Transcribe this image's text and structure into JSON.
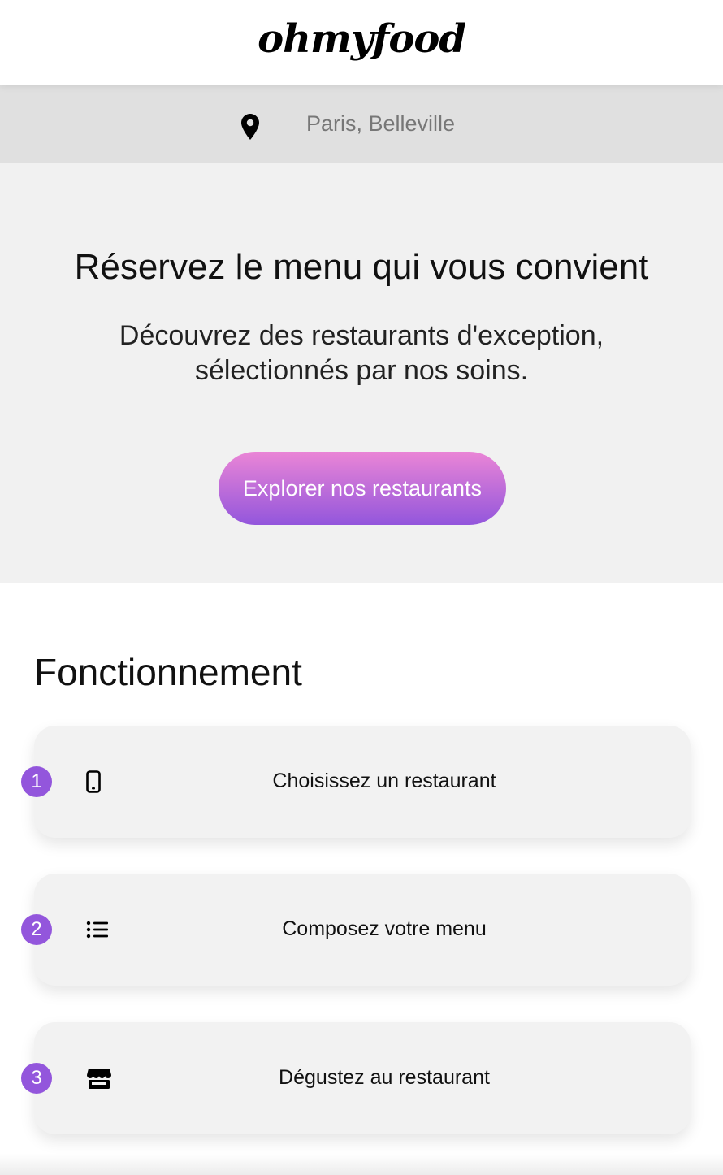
{
  "header": {
    "logo_text": "ohmyfood"
  },
  "location": {
    "icon": "location-pin-icon",
    "text": "Paris, Belleville"
  },
  "hero": {
    "title": "Réservez le menu qui vous convient",
    "subtitle_line1": "Découvrez des restaurants d'exception,",
    "subtitle_line2": "sélectionnés par nos soins.",
    "button_label": "Explorer nos restaurants"
  },
  "how_it_works": {
    "title": "Fonctionnement",
    "steps": [
      {
        "number": "1",
        "icon": "mobile-phone-icon",
        "label": "Choisissez un restaurant"
      },
      {
        "number": "2",
        "icon": "list-icon",
        "label": "Composez votre menu"
      },
      {
        "number": "3",
        "icon": "store-icon",
        "label": "Dégustez au restaurant"
      }
    ]
  },
  "colors": {
    "accent_purple": "#9356dc",
    "accent_pink": "#ea85d6",
    "hero_bg": "#f1f1f1",
    "location_bg": "#e0e0e0"
  }
}
